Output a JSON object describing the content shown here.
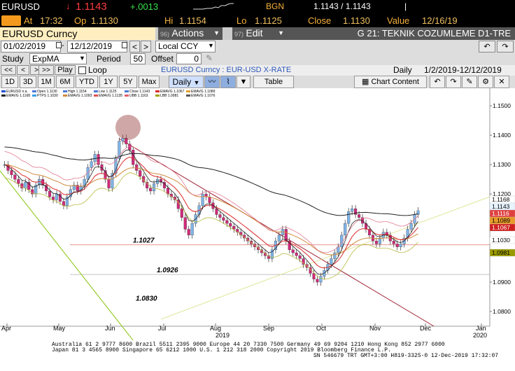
{
  "quote_bar": {
    "ticker": "EURUSD",
    "arrow": "↓",
    "last": "1.1143",
    "change": "+.0013",
    "source": "BGN",
    "bid_ask": "1.1143 / 1.1143",
    "bid_ask_size": "|",
    "at_label": "At",
    "time": "17:32",
    "op_label": "Op",
    "open": "1.1130",
    "hi_label": "Hi",
    "high": "1.1154",
    "lo_label": "Lo",
    "low": "1.1125",
    "close_label": "Close",
    "close": "1.1130",
    "value_label": "Value",
    "value_date": "12/16/19"
  },
  "command_bar": {
    "security": "EURUSD  Curncy",
    "actions_num": "96)",
    "actions_label": "Actions",
    "edit_num": "97)",
    "edit_label": "Edit",
    "page_title": "G 21: TEKNIK COZUMLEME D1-TRE"
  },
  "date_bar": {
    "start_date": "01/02/2019",
    "end_date": "12/12/2019",
    "currency": "Local CCY",
    "prev_arrow": "<",
    "next_arrow": ">"
  },
  "study_bar": {
    "study_label": "Study",
    "study_value": "ExpMA",
    "period_label": "Period",
    "period_value": "50",
    "offset_label": "Offset",
    "offset_value": "0"
  },
  "play_bar": {
    "first": "<<",
    "back": "<",
    "fwd": ">",
    "last": ">>",
    "play": "Play",
    "loop": "Loop",
    "security_desc": "EURUSD  Curncy : EUR-USD X-RATE",
    "frequency": "Daily",
    "range": "1/2/2019-12/12/2019"
  },
  "toolbar": {
    "periods": [
      "1D",
      "3D",
      "1M",
      "6M",
      "YTD",
      "1Y",
      "5Y",
      "Max"
    ],
    "frequency": "Daily",
    "table": "Table",
    "chart_content": "Chart Content"
  },
  "legend": [
    [
      "EURUSD",
      "n.a.",
      "#1f4fcf"
    ],
    [
      "Open",
      "1.1130",
      "#4a7bd6"
    ],
    [
      "High",
      "1.1154",
      "#4a7bd6"
    ],
    [
      "Low",
      "1.1125",
      "#4a7bd6"
    ],
    [
      "Close",
      "1.1143",
      "#4a7bd6"
    ],
    [
      "EMAVG",
      "1.1067",
      "#d92a2a"
    ],
    [
      "EMAVG",
      "1.1089",
      "#e0a030"
    ],
    [
      "EMAVG",
      "1.1168",
      "#222222"
    ],
    [
      "PTPS",
      "1.1030",
      "#3aa0e8"
    ],
    [
      "EMAVG",
      "1.1093",
      "#d08b40"
    ],
    [
      "EMAVG",
      "1.1135",
      "#e05050"
    ],
    [
      "UBB",
      "1.1163",
      "#e06070"
    ],
    [
      "LBB",
      "1.0981",
      "#a0a000"
    ],
    [
      "EMAVG",
      "1.1076",
      "#555555"
    ]
  ],
  "chart_data": {
    "type": "candlestick",
    "title": "EURUSD  Curncy : EUR-USD X-RATE",
    "frequency": "Daily",
    "x_labels": [
      "Apr",
      "May",
      "Jun",
      "Jul",
      "Aug",
      "Sep",
      "Oct",
      "Nov",
      "Dec",
      "Jan"
    ],
    "year_labels": [
      "2019",
      "2020"
    ],
    "y_ticks": [
      "1.1500",
      "1.1400",
      "1.1300",
      "1.1200",
      "1.1100",
      "1.1000",
      "1.0900",
      "1.0800"
    ],
    "ylim": [
      1.075,
      1.156
    ],
    "levels": [
      {
        "label": "1.1027",
        "value": 1.1027
      },
      {
        "label": "1.0926",
        "value": 1.0926
      },
      {
        "label": "1.0830",
        "value": 1.083
      }
    ],
    "right_tags": [
      {
        "text": "1.1168",
        "bg": "#ffffff",
        "fg": "#000000"
      },
      {
        "text": "1.1143",
        "bg": "#e8f4ff",
        "fg": "#000000"
      },
      {
        "text": "1.1116",
        "bg": "#e04040",
        "fg": "#ffffff"
      },
      {
        "text": "1.1089",
        "bg": "#e89a2a",
        "fg": "#000000"
      },
      {
        "text": "1.1067",
        "bg": "#d02020",
        "fg": "#ffffff"
      },
      {
        "text": "1.1030",
        "bg": "#ffffff",
        "fg": "#000000"
      },
      {
        "text": "1.0981",
        "bg": "#9a9a00",
        "fg": "#000000"
      }
    ],
    "close_series": [
      1.13,
      1.128,
      1.1265,
      1.125,
      1.1235,
      1.122,
      1.124,
      1.1215,
      1.12,
      1.123,
      1.125,
      1.123,
      1.121,
      1.119,
      1.118,
      1.12,
      1.1175,
      1.116,
      1.119,
      1.1215,
      1.123,
      1.121,
      1.1225,
      1.125,
      1.129,
      1.131,
      1.1335,
      1.13,
      1.128,
      1.125,
      1.122,
      1.127,
      1.132,
      1.138,
      1.139,
      1.137,
      1.135,
      1.13,
      1.128,
      1.126,
      1.124,
      1.122,
      1.121,
      1.1235,
      1.125,
      1.124,
      1.122,
      1.12,
      1.119,
      1.118,
      1.115,
      1.112,
      1.108,
      1.106,
      1.11,
      1.113,
      1.116,
      1.12,
      1.119,
      1.117,
      1.115,
      1.113,
      1.112,
      1.111,
      1.11,
      1.109,
      1.108,
      1.107,
      1.106,
      1.105,
      1.104,
      1.103,
      1.102,
      1.101,
      1.1,
      1.099,
      1.098,
      1.101,
      1.104,
      1.106,
      1.108,
      1.104,
      1.101,
      1.1,
      1.099,
      1.098,
      1.096,
      1.095,
      1.093,
      1.091,
      1.09,
      1.092,
      1.094,
      1.096,
      1.098,
      1.1,
      1.102,
      1.106,
      1.11,
      1.114,
      1.115,
      1.113,
      1.112,
      1.11,
      1.108,
      1.106,
      1.104,
      1.103,
      1.105,
      1.107,
      1.106,
      1.104,
      1.103,
      1.102,
      1.103,
      1.105,
      1.108,
      1.11,
      1.113,
      1.1143
    ]
  }
}
